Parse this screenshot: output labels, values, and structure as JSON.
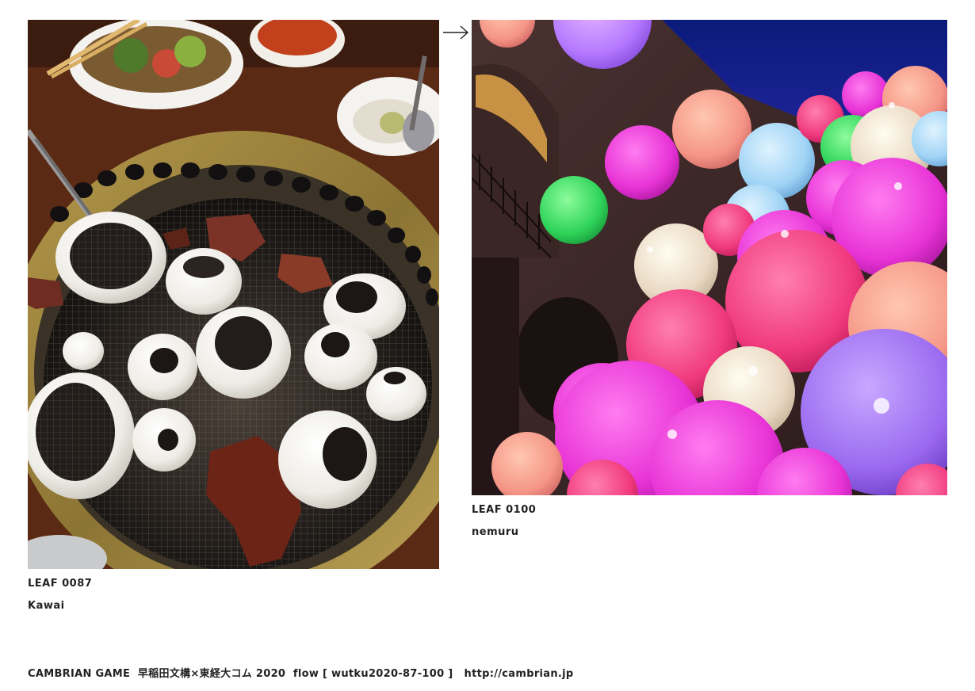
{
  "leaves": [
    {
      "code": "LEAF 0087",
      "name": "Kawai",
      "image": "photo of yakiniku grill with onion rings and meat"
    },
    {
      "code": "LEAF 0100",
      "name": "nemuru",
      "image": "photo of glowing illuminated balloons"
    }
  ],
  "navigation": {
    "next_icon": "right-arrow-icon"
  },
  "footer": {
    "text": "CAMBRIAN GAME  早稲田文構×東経大コム 2020  flow [ wutku2020-87-100 ]",
    "url": "http://cambrian.jp"
  }
}
